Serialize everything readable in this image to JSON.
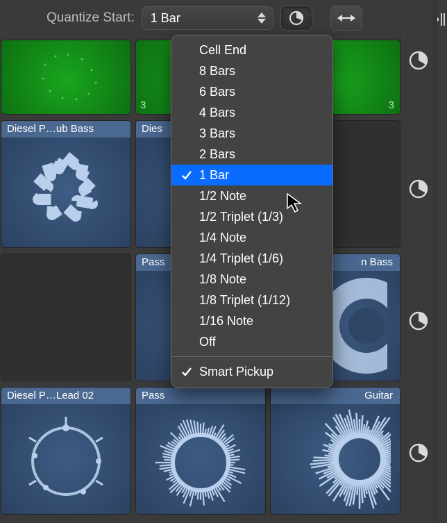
{
  "toolbar": {
    "quantize_label": "Quantize Start:",
    "selected_value": "1 Bar"
  },
  "menu": {
    "items": [
      {
        "label": "Cell End",
        "selected": false,
        "checked": false
      },
      {
        "label": "8 Bars",
        "selected": false,
        "checked": false
      },
      {
        "label": "6 Bars",
        "selected": false,
        "checked": false
      },
      {
        "label": "4 Bars",
        "selected": false,
        "checked": false
      },
      {
        "label": "3 Bars",
        "selected": false,
        "checked": false
      },
      {
        "label": "2 Bars",
        "selected": false,
        "checked": false
      },
      {
        "label": "1 Bar",
        "selected": true,
        "checked": true
      },
      {
        "label": "1/2 Note",
        "selected": false,
        "checked": false
      },
      {
        "label": "1/2 Triplet (1/3)",
        "selected": false,
        "checked": false
      },
      {
        "label": "1/4 Note",
        "selected": false,
        "checked": false
      },
      {
        "label": "1/4 Triplet (1/6)",
        "selected": false,
        "checked": false
      },
      {
        "label": "1/8 Note",
        "selected": false,
        "checked": false
      },
      {
        "label": "1/8 Triplet (1/12)",
        "selected": false,
        "checked": false
      },
      {
        "label": "1/16 Note",
        "selected": false,
        "checked": false
      },
      {
        "label": "Off",
        "selected": false,
        "checked": false
      }
    ],
    "footer": {
      "label": "Smart Pickup",
      "checked": true
    }
  },
  "cells": {
    "green_a_marker": "3",
    "green_b_marker": "3",
    "blue": {
      "r1c1": "Diesel P…ub Bass",
      "r1c2": "Dies",
      "r2c2": "Pass",
      "r2c3": "n Bass",
      "r3c1": "Diesel P…Lead 02",
      "r3c2": "Pass",
      "r3c3": "Guitar"
    }
  }
}
